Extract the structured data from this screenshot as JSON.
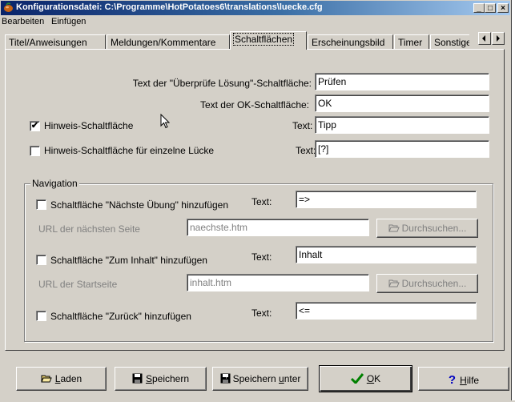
{
  "window": {
    "title": "Konfigurationsdatei: C:\\Programme\\HotPotatoes6\\translations\\luecke.cfg",
    "minimize": "_",
    "maximize": "□",
    "close": "×"
  },
  "menu": [
    "Bearbeiten",
    "Einfügen"
  ],
  "tabs": [
    {
      "label": "Titel/Anweisungen"
    },
    {
      "label": "Meldungen/Kommentare"
    },
    {
      "label": "Schaltflächen"
    },
    {
      "label": "Erscheinungsbild"
    },
    {
      "label": "Timer"
    },
    {
      "label": "Sonstige"
    }
  ],
  "active_tab": "Schaltflächen",
  "fields": {
    "check_label": "Text der \"Überprüfe Lösung\"-Schaltfläche:",
    "check_value": "Prüfen",
    "ok_label": "Text der OK-Schaltfläche:",
    "ok_value": "OK",
    "hint_check_label": "Hinweis-Schaltfläche",
    "hint_checked": true,
    "hint_text_label": "Text:",
    "hint_value": "Tipp",
    "gap_hint_label": "Hinweis-Schaltfläche für einzelne Lücke",
    "gap_hint_checked": false,
    "gap_text_label": "Text:",
    "gap_hint_value": "[?]"
  },
  "navigation": {
    "title": "Navigation",
    "next_label": "Schaltfläche \"Nächste Übung\" hinzufügen",
    "next_checked": false,
    "next_text_label": "Text:",
    "next_value": "=>",
    "next_url_label": "URL der nächsten Seite",
    "next_url_value": "naechste.htm",
    "browse1": "Durchsuchen...",
    "contents_label": "Schaltfläche \"Zum Inhalt\" hinzufügen",
    "contents_checked": false,
    "contents_text_label": "Text:",
    "contents_value": "Inhalt",
    "start_url_label": "URL der Startseite",
    "start_url_value": "inhalt.htm",
    "browse2": "Durchsuchen...",
    "back_label": "Schaltfläche \"Zurück\" hinzufügen",
    "back_checked": false,
    "back_text_label": "Text:",
    "back_value": "<="
  },
  "buttons": {
    "load": "Laden",
    "save": "Speichern",
    "save_as": "Speichern unter",
    "ok": "OK",
    "help": "Hilfe"
  },
  "colors": {
    "titlebar_start": "#0a246a",
    "titlebar_end": "#a6caf0",
    "face": "#d4d0c8"
  }
}
